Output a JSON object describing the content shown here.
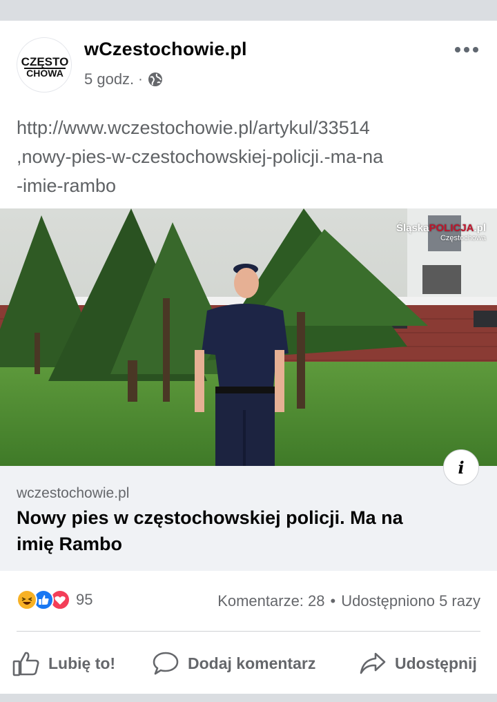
{
  "post": {
    "page_name": "wCzestochowie.pl",
    "avatar_text_top": "CZĘSTO",
    "avatar_text_bottom": "CHOWA",
    "time": "5 godz.",
    "separator": "·",
    "privacy_icon": "globe-icon",
    "more_icon": "more-dots-icon",
    "text_lines": [
      "http://www.wczestochowie.pl/artykul/33514",
      ",nowy-pies-w-czestochowskiej-policji.-ma-na",
      "-imie-rambo"
    ]
  },
  "photo": {
    "watermark_prefix": "Śląska",
    "watermark_brand": "POLICJA",
    "watermark_suffix": ".pl",
    "watermark_sub": "Częstochowa"
  },
  "link_card": {
    "info_icon": "info-icon",
    "info_label": "i",
    "domain": "wczestochowie.pl",
    "headline_lines": [
      "Nowy pies w częstochowskiej policji. Ma na",
      "imię Rambo"
    ]
  },
  "stats": {
    "reaction_icons": [
      "haha-icon",
      "like-icon",
      "love-icon"
    ],
    "reaction_count": "95",
    "comments": "Komentarze: 28",
    "separator": "•",
    "shares": "Udostępniono 5 razy"
  },
  "actions": {
    "like_label": "Lubię to!",
    "comment_label": "Dodaj komentarz",
    "share_label": "Udostępnij"
  },
  "colors": {
    "text_primary": "#050505",
    "text_secondary": "#65676b",
    "like_blue": "#1877f2",
    "love_red": "#f33e58",
    "haha_yellow": "#f7b125"
  }
}
